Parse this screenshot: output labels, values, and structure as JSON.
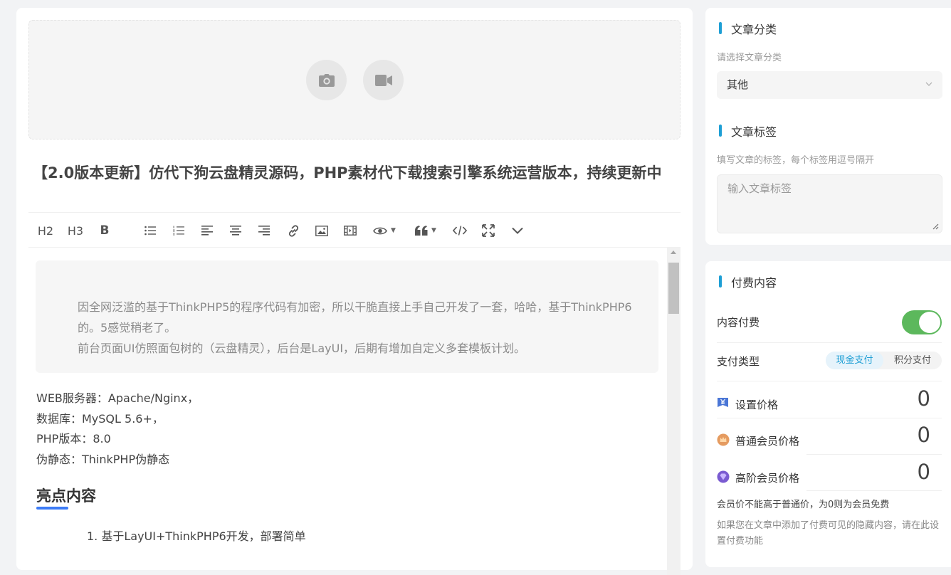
{
  "editor": {
    "cover": {
      "photo_icon": "camera-icon",
      "video_icon": "video-camera-icon"
    },
    "title": "【2.0版本更新】仿代下狗云盘精灵源码，PHP素材代下载搜索引擎系统运营版本，持续更新中",
    "toolbar": {
      "h2": "H2",
      "h3": "H3",
      "bold": "B",
      "icons": [
        "bullet-list-icon",
        "ordered-list-icon",
        "align-left-icon",
        "align-center-icon",
        "align-right-icon",
        "link-icon",
        "image-icon",
        "video-icon",
        "eye-icon",
        "quote-icon",
        "code-icon",
        "fullscreen-icon",
        "chevron-down-icon"
      ],
      "caret": "▼"
    },
    "quote": {
      "line1": "因全网泛滥的基于ThinkPHP5的程序代码有加密，所以干脆直接上手自己开发了一套，哈哈，基于ThinkPHP6的。5感觉稍老了。",
      "line2": "前台页面UI仿照面包树的（云盘精灵），后台是LayUI，后期有增加自定义多套模板计划。"
    },
    "body": [
      "WEB服务器：Apache/Nginx，",
      "数据库：MySQL 5.6+，",
      "PHP版本：8.0",
      "伪静态：ThinkPHP伪静态"
    ],
    "heading": "亮点内容",
    "list_item": "1. 基于LayUI+ThinkPHP6开发，部署简单"
  },
  "category": {
    "title": "文章分类",
    "hint": "请选择文章分类",
    "selected": "其他"
  },
  "tags": {
    "title": "文章标签",
    "hint": "填写文章的标签，每个标签用逗号隔开",
    "placeholder": "输入文章标签"
  },
  "paid": {
    "title": "付费内容",
    "toggle_label": "内容付费",
    "toggle_on": true,
    "paytype_label": "支付类型",
    "paytype_options": [
      "现金支付",
      "积分支付"
    ],
    "paytype_selected": "现金支付",
    "prices": [
      {
        "label": "设置价格",
        "value": "0",
        "icon": "yen-ticket-icon"
      },
      {
        "label": "普通会员价格",
        "value": "0",
        "icon": "crown-badge-icon"
      },
      {
        "label": "高阶会员价格",
        "value": "0",
        "icon": "diamond-badge-icon"
      }
    ],
    "note1": "会员价不能高于普通价，为0则为会员免费",
    "note2": "如果您在文章中添加了付费可见的隐藏内容，请在此设置付费功能"
  },
  "colors": {
    "accent": "#1e9fd5",
    "toggle": "#5cb85c",
    "heading_underline": "#3d7cf6"
  }
}
